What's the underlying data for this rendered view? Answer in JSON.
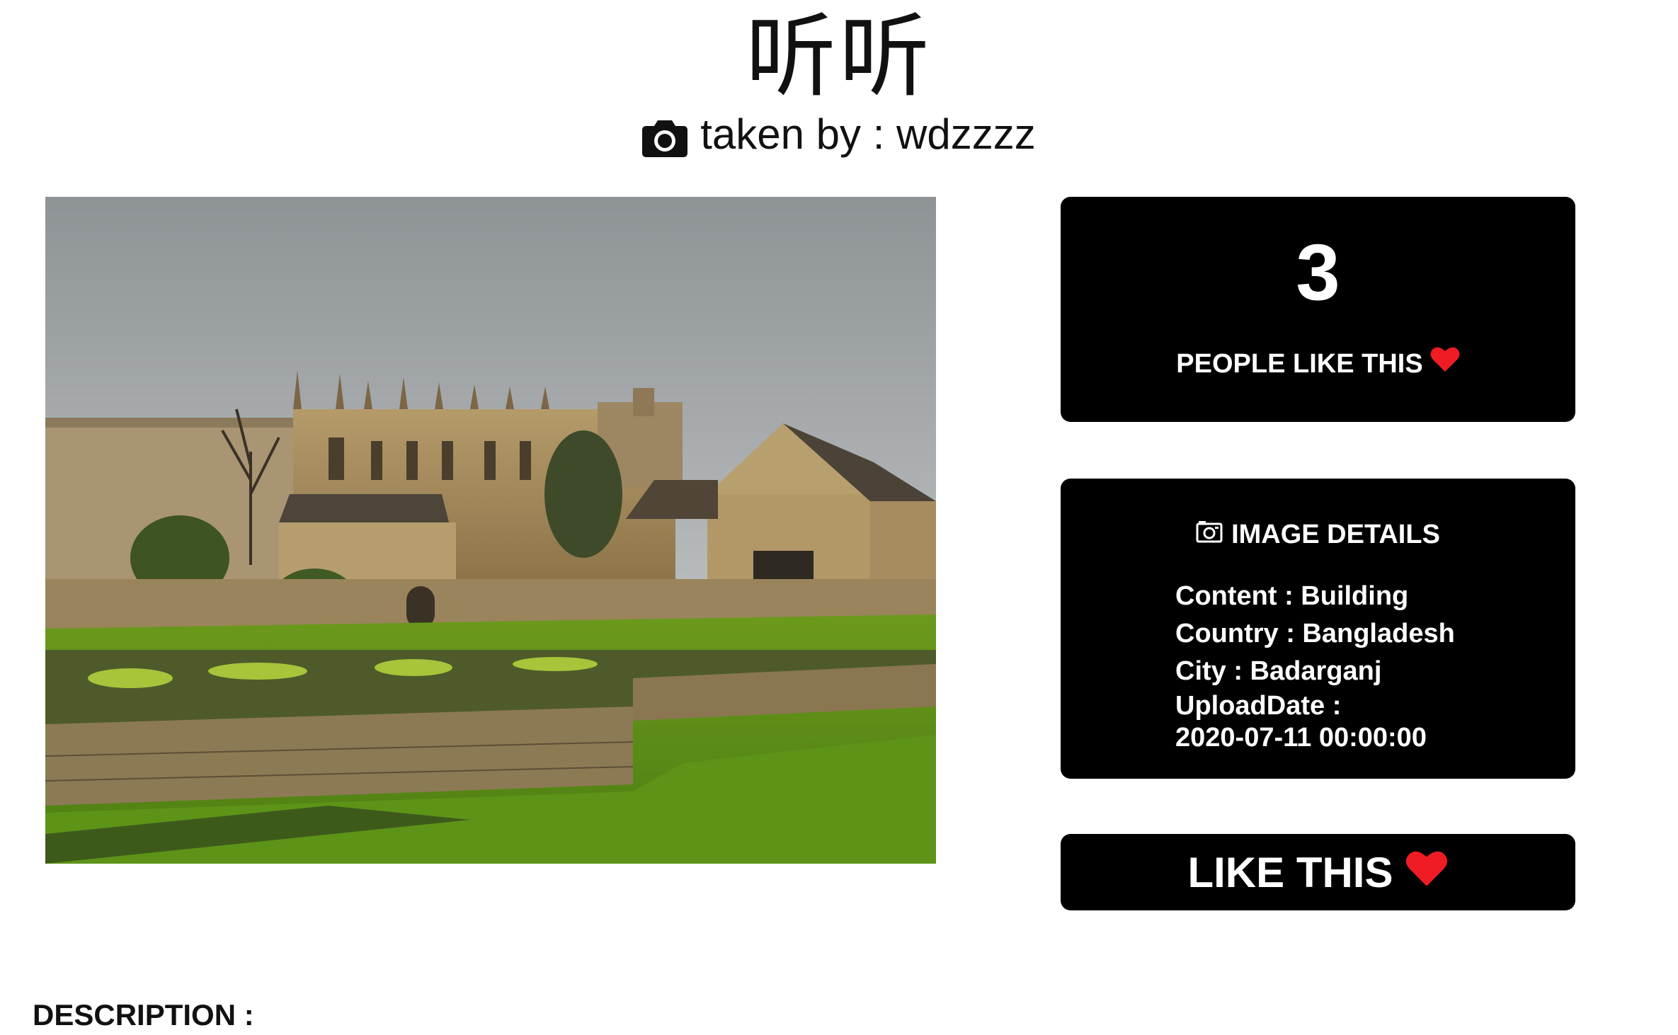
{
  "header": {
    "title": "听听",
    "byline": "taken by : wdzzzz"
  },
  "likes": {
    "count": "3",
    "label": "PEOPLE LIKE THIS"
  },
  "details": {
    "title": "IMAGE DETAILS",
    "content": "Content : Building",
    "country": "Country : Bangladesh",
    "city": "City : Badarganj",
    "upload_label": "UploadDate :",
    "upload_value": "2020-07-11 00:00:00"
  },
  "like_button": {
    "label": "LIKE THIS"
  },
  "description": {
    "label": "DESCRIPTION :"
  },
  "colors": {
    "heart": "#f01c24",
    "card_bg": "#000000"
  },
  "icons": {
    "camera": "camera-icon",
    "photo_camera": "image-details-icon",
    "heart": "heart-icon"
  }
}
